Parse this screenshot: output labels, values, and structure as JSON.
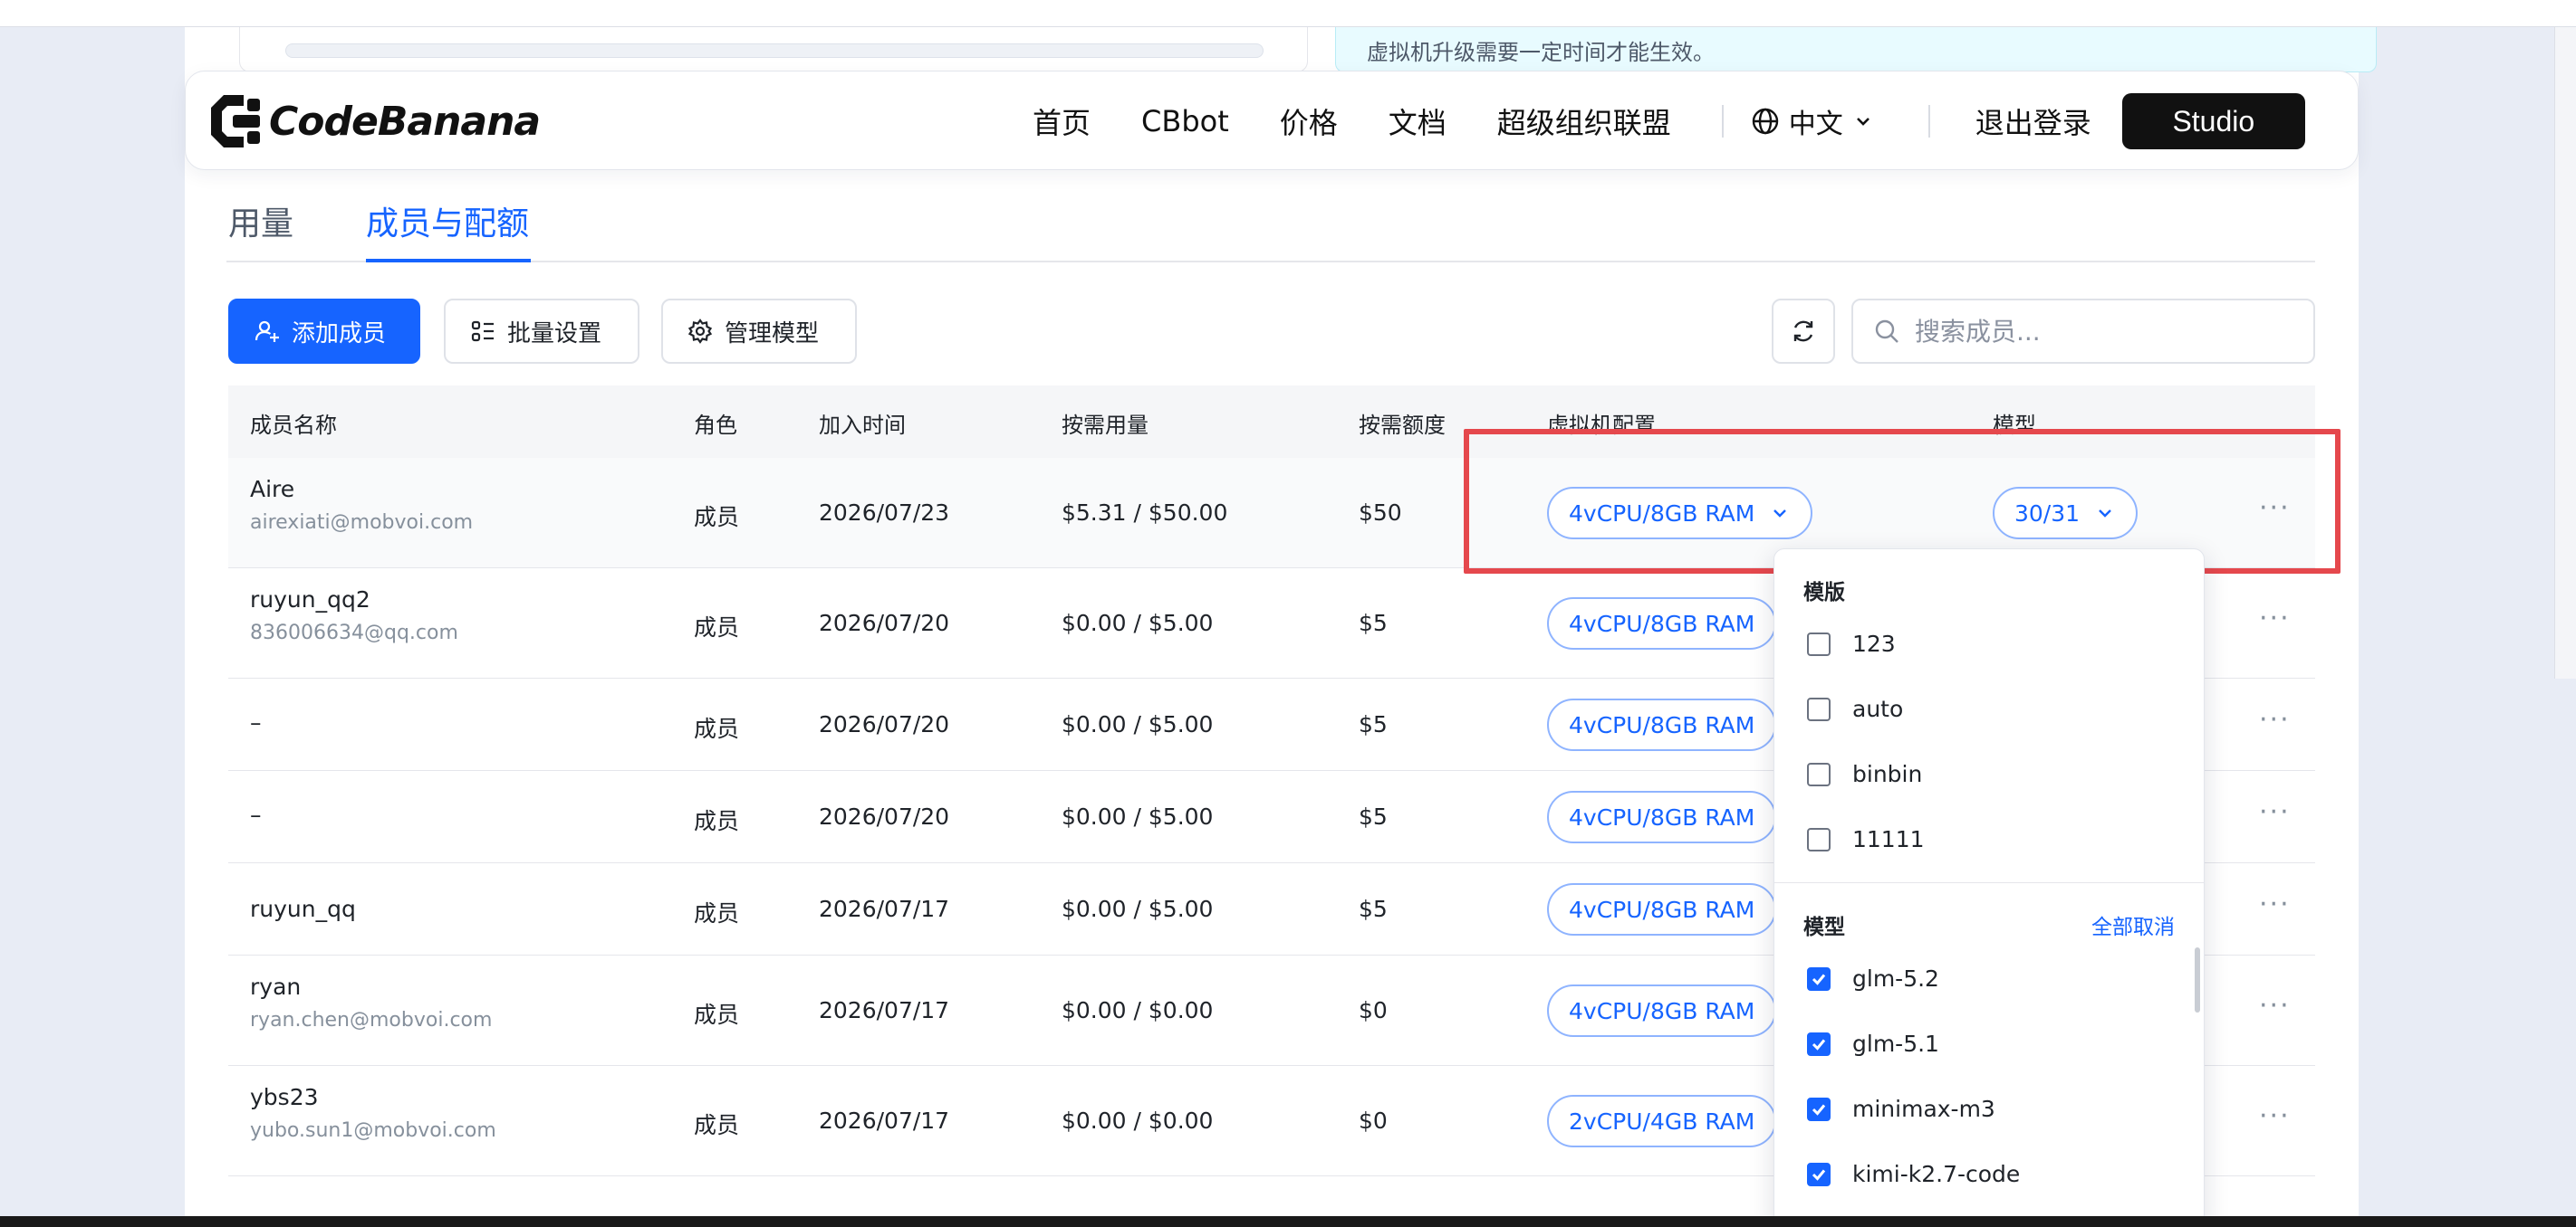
{
  "prev_notice": "虚拟机升级需要一定时间才能生效。",
  "nav": {
    "brand": "CodeBanana",
    "links": [
      "首页",
      "CBbot",
      "价格",
      "文档",
      "超级组织联盟"
    ],
    "language": "中文",
    "logout": "退出登录",
    "studio": "Studio"
  },
  "tabs": {
    "usage": "用量",
    "members": "成员与配额"
  },
  "toolbar": {
    "add_member": "添加成员",
    "batch_settings": "批量设置",
    "manage_models": "管理模型",
    "search_placeholder": "搜索成员..."
  },
  "table": {
    "headers": {
      "name": "成员名称",
      "role": "角色",
      "joined": "加入时间",
      "usage": "按需用量",
      "quota": "按需额度",
      "vm": "虚拟机配置",
      "model": "模型"
    },
    "rows": [
      {
        "name": "Aire",
        "email": "airexiati@mobvoi.com",
        "role": "成员",
        "joined": "2026/07/23",
        "usage": "$5.31 / $50.00",
        "quota": "$50",
        "vm": "4vCPU/8GB RAM",
        "model": "30/31"
      },
      {
        "name": "ruyun_qq2",
        "email": "836006634@qq.com",
        "role": "成员",
        "joined": "2026/07/20",
        "usage": "$0.00 / $5.00",
        "quota": "$5",
        "vm": "4vCPU/8GB RAM"
      },
      {
        "name": "–",
        "role": "成员",
        "joined": "2026/07/20",
        "usage": "$0.00 / $5.00",
        "quota": "$5",
        "vm": "4vCPU/8GB RAM"
      },
      {
        "name": "–",
        "role": "成员",
        "joined": "2026/07/20",
        "usage": "$0.00 / $5.00",
        "quota": "$5",
        "vm": "4vCPU/8GB RAM"
      },
      {
        "name": "ruyun_qq",
        "role": "成员",
        "joined": "2026/07/17",
        "usage": "$0.00 / $5.00",
        "quota": "$5",
        "vm": "4vCPU/8GB RAM"
      },
      {
        "name": "ryan",
        "email": "ryan.chen@mobvoi.com",
        "role": "成员",
        "joined": "2026/07/17",
        "usage": "$0.00 / $0.00",
        "quota": "$0",
        "vm": "4vCPU/8GB RAM"
      },
      {
        "name": "ybs23",
        "email": "yubo.sun1@mobvoi.com",
        "role": "成员",
        "joined": "2026/07/17",
        "usage": "$0.00 / $0.00",
        "quota": "$0",
        "vm": "2vCPU/4GB RAM"
      }
    ]
  },
  "dropdown": {
    "templates_label": "模版",
    "templates": [
      {
        "label": "123",
        "checked": false
      },
      {
        "label": "auto",
        "checked": false
      },
      {
        "label": "binbin",
        "checked": false
      },
      {
        "label": "11111",
        "checked": false
      }
    ],
    "models_label": "模型",
    "deselect_all": "全部取消",
    "models": [
      {
        "label": "glm-5.2",
        "checked": true
      },
      {
        "label": "glm-5.1",
        "checked": true
      },
      {
        "label": "minimax-m3",
        "checked": true
      },
      {
        "label": "kimi-k2.7-code",
        "checked": true
      }
    ]
  },
  "colors": {
    "accent": "#1664ff",
    "highlight": "#e5484d",
    "studio_bg": "#111111"
  }
}
